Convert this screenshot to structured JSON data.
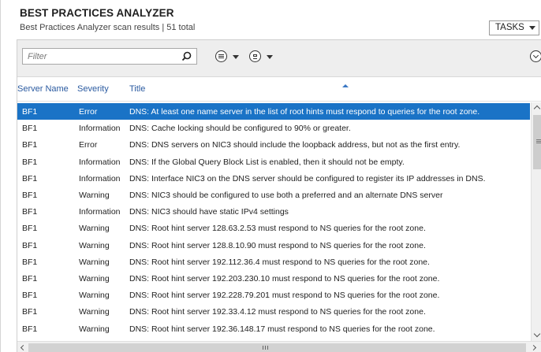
{
  "header": {
    "title": "BEST PRACTICES ANALYZER",
    "subtitle": "Best Practices Analyzer scan results | 51 total",
    "tasks_label": "TASKS"
  },
  "toolbar": {
    "filter_placeholder": "Filter",
    "icons": [
      "search-icon",
      "list-options-icon",
      "save-icon",
      "expand-icon"
    ]
  },
  "columns": [
    "Server Name",
    "Severity",
    "Title"
  ],
  "rows": [
    {
      "server": "BF1",
      "severity": "Error",
      "title": "DNS: At least one name server in the list of root hints must respond to queries for the root zone."
    },
    {
      "server": "BF1",
      "severity": "Information",
      "title": "DNS: Cache locking should be configured to 90% or greater."
    },
    {
      "server": "BF1",
      "severity": "Error",
      "title": "DNS: DNS servers on NIC3 should include the loopback address, but not as the first entry."
    },
    {
      "server": "BF1",
      "severity": "Information",
      "title": "DNS: If the Global Query Block List is enabled, then it should not be empty."
    },
    {
      "server": "BF1",
      "severity": "Information",
      "title": "DNS: Interface NIC3 on the DNS server should be configured to register its IP addresses in DNS."
    },
    {
      "server": "BF1",
      "severity": "Warning",
      "title": "DNS: NIC3 should be configured to use both a preferred and an alternate DNS server"
    },
    {
      "server": "BF1",
      "severity": "Information",
      "title": "DNS: NIC3 should have static IPv4 settings"
    },
    {
      "server": "BF1",
      "severity": "Warning",
      "title": "DNS: Root hint server 128.63.2.53 must respond to NS queries for the root zone."
    },
    {
      "server": "BF1",
      "severity": "Warning",
      "title": "DNS: Root hint server 128.8.10.90 must respond to NS queries for the root zone."
    },
    {
      "server": "BF1",
      "severity": "Warning",
      "title": "DNS: Root hint server 192.112.36.4 must respond to NS queries for the root zone."
    },
    {
      "server": "BF1",
      "severity": "Warning",
      "title": "DNS: Root hint server 192.203.230.10 must respond to NS queries for the root zone."
    },
    {
      "server": "BF1",
      "severity": "Warning",
      "title": "DNS: Root hint server 192.228.79.201 must respond to NS queries for the root zone."
    },
    {
      "server": "BF1",
      "severity": "Warning",
      "title": "DNS: Root hint server 192.33.4.12 must respond to NS queries for the root zone."
    },
    {
      "server": "BF1",
      "severity": "Warning",
      "title": "DNS: Root hint server 192.36.148.17 must respond to NS queries for the root zone."
    }
  ],
  "selected_row": 0,
  "colors": {
    "selection": "#1a73c6",
    "header_text": "#2a5aa0"
  }
}
